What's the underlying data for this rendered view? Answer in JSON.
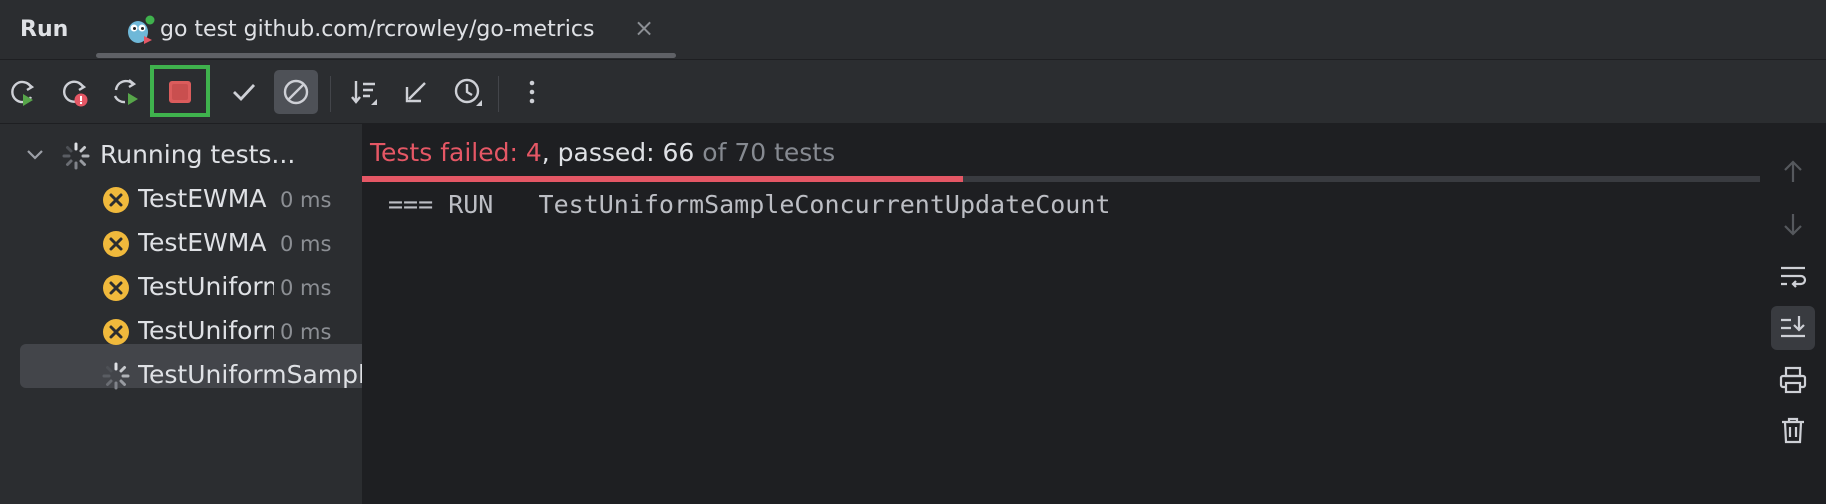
{
  "tabbar": {
    "run_label": "Run",
    "tab_title": "go test github.com/rcrowley/go-metrics",
    "tab_icon": "gopher-run-icon",
    "close_glyph": "×"
  },
  "toolbar": {
    "items": [
      "rerun-icon",
      "rerun-failed-icon",
      "rerun-automatically-icon",
      "stop-icon",
      "show-passed-icon",
      "show-ignored-icon",
      "sort-icon",
      "collapse-icon",
      "history-icon",
      "more-icon"
    ]
  },
  "tree": {
    "root_label": "Running tests...",
    "items": [
      {
        "name": "TestEWMA",
        "time": "0 ms",
        "status": "failed"
      },
      {
        "name": "TestEWMA",
        "time": "0 ms",
        "status": "failed"
      },
      {
        "name": "TestUniform",
        "time": "0 ms",
        "status": "failed"
      },
      {
        "name": "TestUniform",
        "time": "0 ms",
        "status": "failed"
      },
      {
        "name": "TestUniformSample",
        "time": "",
        "status": "running"
      }
    ]
  },
  "status": {
    "failed_text": "Tests failed: 4",
    "passed_text": ", passed: 66",
    "total_text": " of 70 tests",
    "progress_fraction": 0.429
  },
  "console": {
    "line": "=== RUN   TestUniformSampleConcurrentUpdateCount"
  },
  "colors": {
    "fail": "#e55765",
    "highlight": "#3fb24d",
    "warning": "#f0b93c"
  }
}
